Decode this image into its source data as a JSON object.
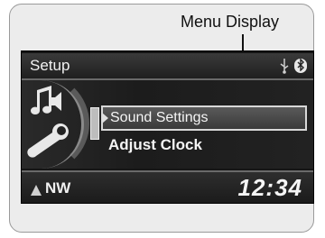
{
  "callout": {
    "label": "Menu Display"
  },
  "header": {
    "title": "Setup",
    "usb_icon": "usb-icon",
    "bt_icon": "bluetooth-icon",
    "bt_glyph": "ʙ"
  },
  "menu": {
    "items": [
      {
        "label": "Sound Settings",
        "selected": true
      },
      {
        "label": "Adjust Clock",
        "selected": false
      }
    ],
    "icons": [
      "audio-icon",
      "wrench-icon"
    ]
  },
  "footer": {
    "compass": "NW",
    "clock": "12:34"
  },
  "colors": {
    "screen_bg": "#151515",
    "text": "#f5f5f5",
    "highlight_border": "#d8d8d8"
  }
}
